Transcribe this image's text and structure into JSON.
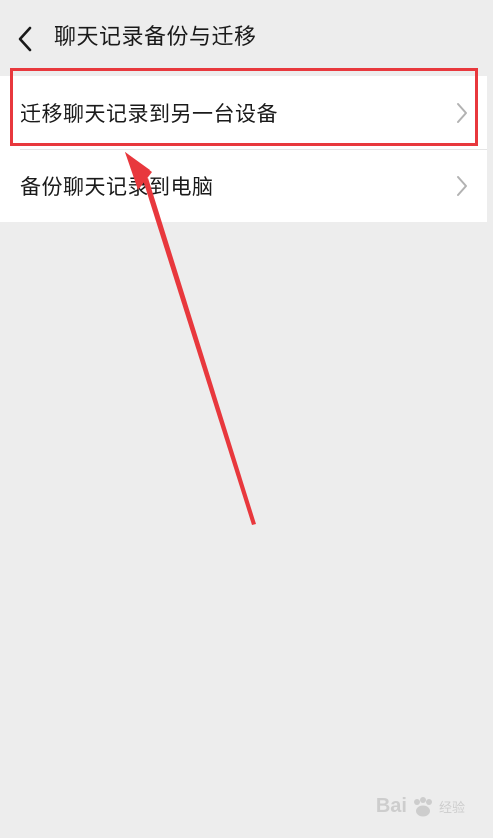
{
  "header": {
    "title": "聊天记录备份与迁移",
    "back_icon": "chevron-left-icon"
  },
  "items": [
    {
      "label": "迁移聊天记录到另一台设备",
      "icon": "chevron-right-icon",
      "highlighted": true
    },
    {
      "label": "备份聊天记录到电脑",
      "icon": "chevron-right-icon",
      "highlighted": false
    }
  ],
  "annotation": {
    "highlight_color": "#e8383d",
    "arrow_color": "#e8383d"
  },
  "watermark": {
    "logo": "Bai",
    "sub": "经验",
    "logo_icon": "paw-icon"
  },
  "colors": {
    "background": "#ededed",
    "list_bg": "#ffffff"
  }
}
